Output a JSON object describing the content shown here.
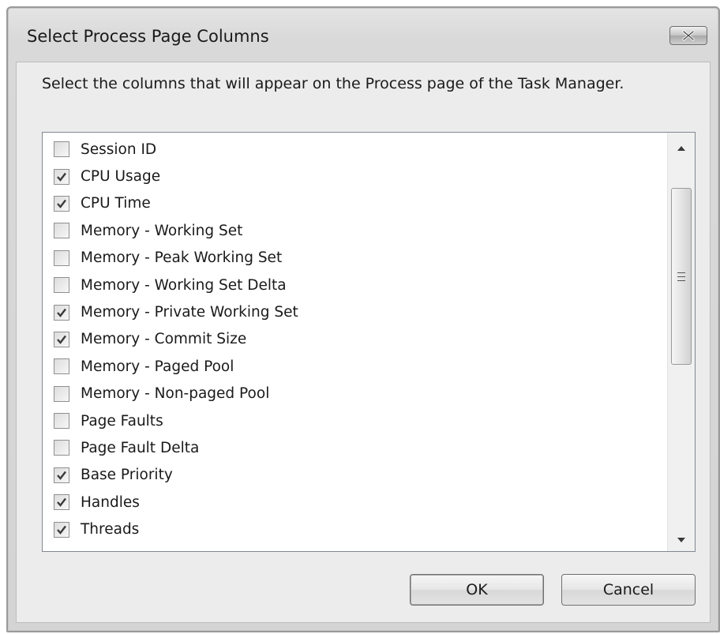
{
  "window": {
    "title": "Select Process Page Columns",
    "close_icon": "close-icon"
  },
  "description": "Select the columns that will appear on the Process page of the Task Manager.",
  "columns": [
    {
      "label": "Session ID",
      "checked": false
    },
    {
      "label": "CPU Usage",
      "checked": true
    },
    {
      "label": "CPU Time",
      "checked": true
    },
    {
      "label": "Memory - Working Set",
      "checked": false
    },
    {
      "label": "Memory - Peak Working Set",
      "checked": false
    },
    {
      "label": "Memory - Working Set Delta",
      "checked": false
    },
    {
      "label": "Memory - Private Working Set",
      "checked": true
    },
    {
      "label": "Memory - Commit Size",
      "checked": true
    },
    {
      "label": "Memory - Paged Pool",
      "checked": false
    },
    {
      "label": "Memory - Non-paged Pool",
      "checked": false
    },
    {
      "label": "Page Faults",
      "checked": false
    },
    {
      "label": "Page Fault Delta",
      "checked": false
    },
    {
      "label": "Base Priority",
      "checked": true
    },
    {
      "label": "Handles",
      "checked": true
    },
    {
      "label": "Threads",
      "checked": true
    }
  ],
  "buttons": {
    "ok": "OK",
    "cancel": "Cancel"
  }
}
